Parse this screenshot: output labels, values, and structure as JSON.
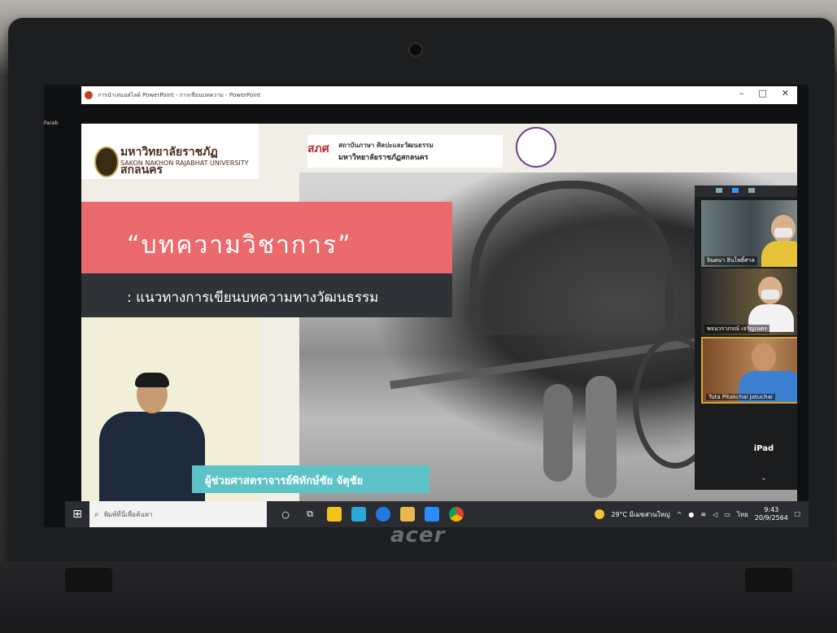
{
  "window": {
    "title": "การนำเสนอสไลด์ PowerPoint - การเขียนบทความ - PowerPoint",
    "side_tab": "Faceb"
  },
  "slide": {
    "university_th": "มหาวิทยาลัยราชภัฏสกลนคร",
    "university_en": "SAKON NAKHON RAJABHAT UNIVERSITY",
    "institute_mark": "สภศ",
    "institute_line1": "สถาบันภาษา ศิลปะและวัฒนธรรม",
    "institute_line2": "มหาวิทยาลัยราชภัฏสกลนคร",
    "title": "“บทความวิชาการ”",
    "subtitle": ": แนวทางการเขียนบทความทางวัฒนธรรม",
    "speaker": "ผู้ช่วยศาสตราจารย์พิทักษ์ชัย จัตุชัย"
  },
  "zoom": {
    "participants": [
      {
        "name": "จินตนา สินโพธิ์ศาล"
      },
      {
        "name": "พจนวราภรณ์ เจริญเนตร"
      },
      {
        "name": "Tuta Pitakchai Jatuchai"
      }
    ],
    "device_label": "iPad",
    "expand_icon": "chevron-down-icon"
  },
  "taskbar": {
    "search_placeholder": "พิมพ์ที่นี่เพื่อค้นหา",
    "weather": "29°C มีเมฆส่วนใหญ่",
    "language": "ไทย",
    "time": "9:43",
    "date": "20/9/2564"
  },
  "device": {
    "brand": "acer"
  }
}
